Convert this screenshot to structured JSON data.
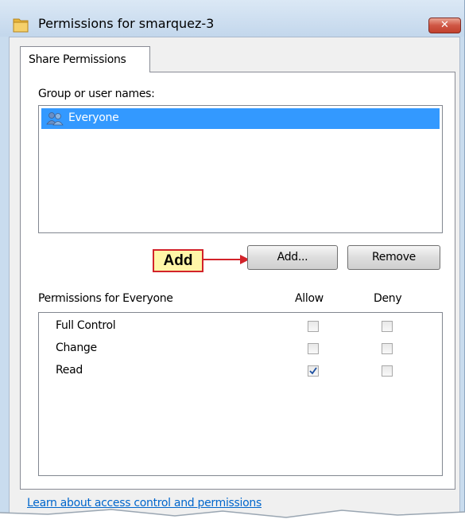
{
  "window": {
    "title": "Permissions for smarquez-3",
    "close_label": "✕"
  },
  "tabs": [
    {
      "label": "Share Permissions",
      "selected": true
    }
  ],
  "users_section": {
    "label": "Group or user names:",
    "items": [
      {
        "name": "Everyone",
        "icon": "users-icon",
        "selected": true
      }
    ]
  },
  "buttons": {
    "add": "Add...",
    "remove": "Remove"
  },
  "callout": {
    "text": "Add",
    "color": "#d2232a",
    "fill": "#fff6a8"
  },
  "permissions": {
    "label": "Permissions for Everyone",
    "columns": [
      "Allow",
      "Deny"
    ],
    "rows": [
      {
        "name": "Full Control",
        "allow": false,
        "deny": false
      },
      {
        "name": "Change",
        "allow": false,
        "deny": false
      },
      {
        "name": "Read",
        "allow": true,
        "deny": false
      }
    ]
  },
  "help_link": "Learn about access control and permissions",
  "colors": {
    "selection": "#3399ff",
    "link": "#0066cc",
    "frame": "#c9dcee",
    "close_button": "#cf5644"
  }
}
